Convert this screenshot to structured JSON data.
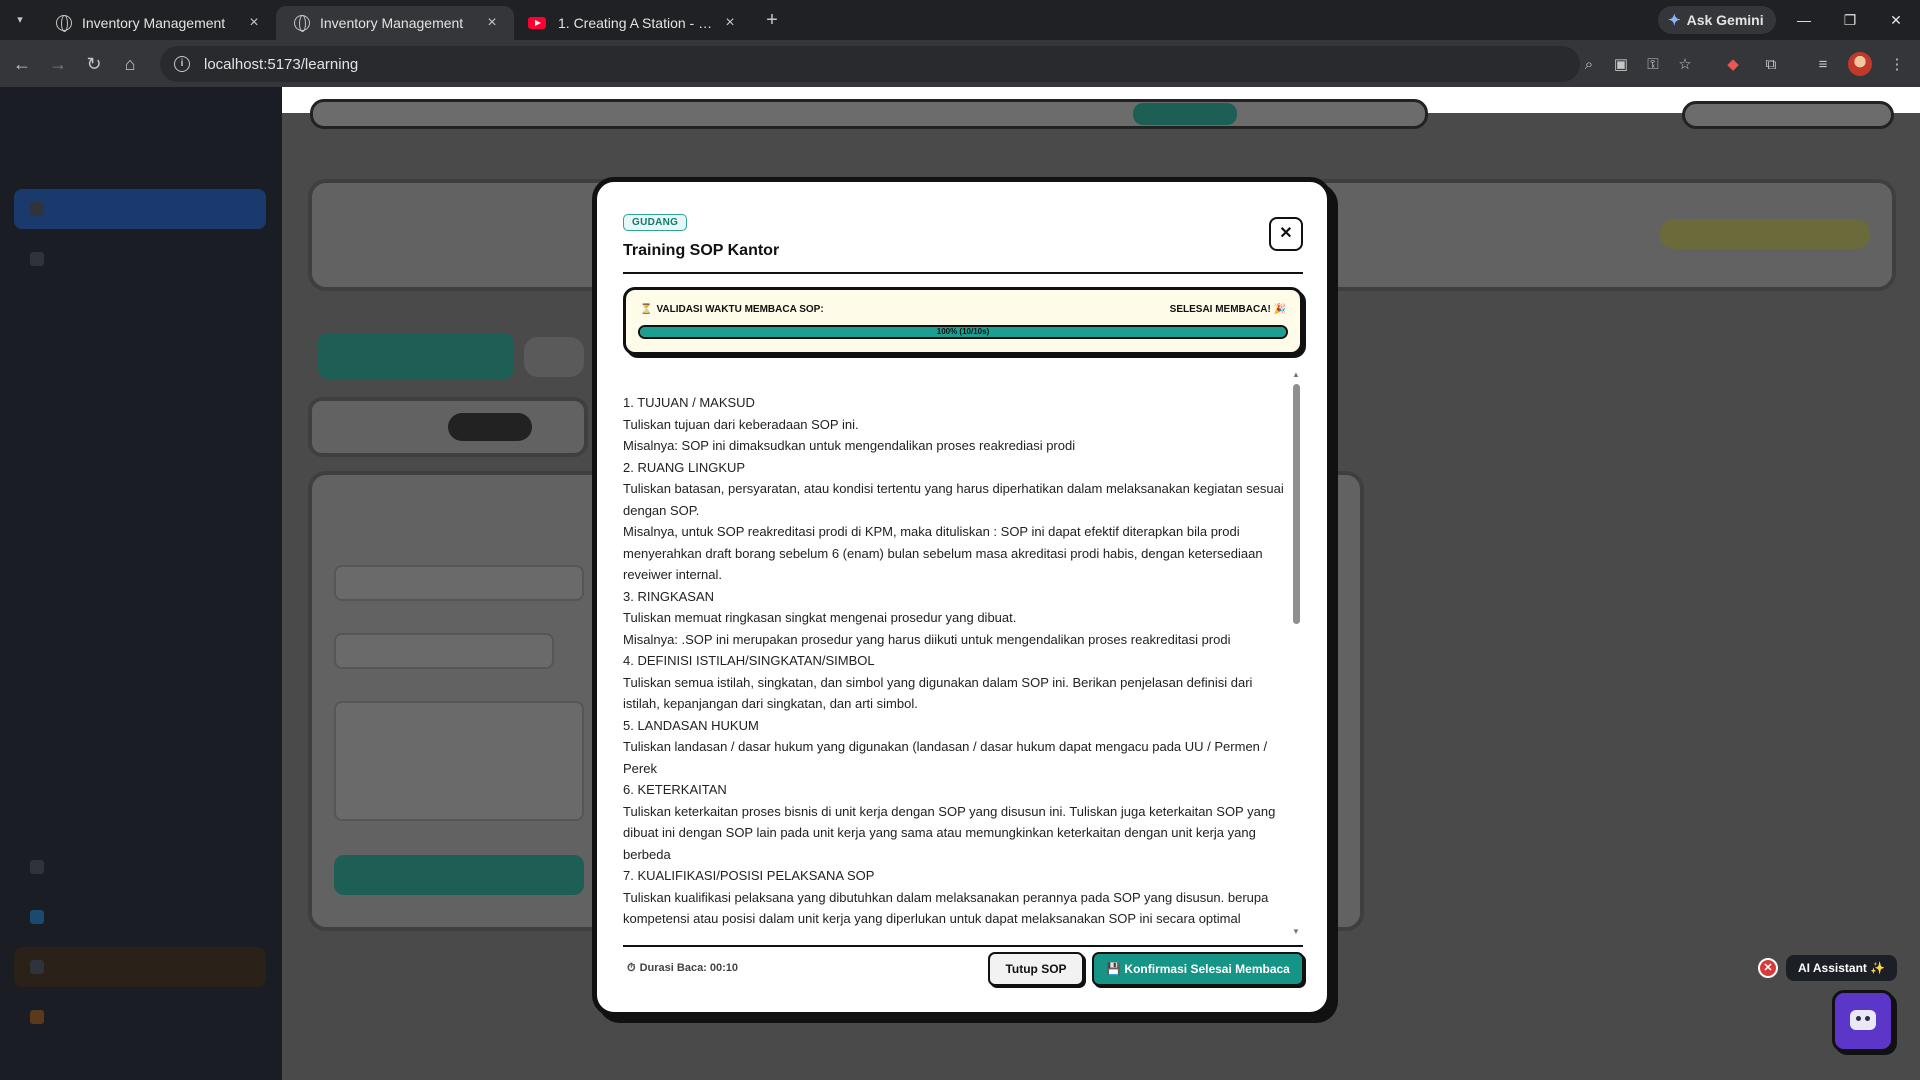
{
  "browser": {
    "tabs": [
      {
        "label": "Inventory Management",
        "active": false
      },
      {
        "label": "Inventory Management",
        "active": true
      },
      {
        "label": "1. Creating A Station - Niagara",
        "active": false
      }
    ],
    "ask_gemini": "Ask Gemini",
    "url": "localhost:5173/learning"
  },
  "modal": {
    "badge": "GUDANG",
    "title": "Training SOP Kantor",
    "timer_label": "VALIDASI WAKTU MEMBACA SOP:",
    "timer_done": "SELESAI MEMBACA! 🎉",
    "progress_text": "100% (10/10s)",
    "progress": 1.0,
    "content": [
      "1. TUJUAN / MAKSUD",
      "Tuliskan tujuan dari keberadaan SOP ini.",
      "Misalnya: SOP ini dimaksudkan untuk mengendalikan proses reakrediasi prodi",
      "2. RUANG LINGKUP",
      "Tuliskan batasan, persyaratan, atau kondisi tertentu yang harus diperhatikan dalam melaksanakan kegiatan sesuai dengan SOP.",
      "Misalnya, untuk SOP reakreditasi prodi di KPM, maka dituliskan : SOP ini dapat efektif diterapkan bila prodi menyerahkan draft borang sebelum 6 (enam) bulan sebelum masa akreditasi prodi habis, dengan ketersediaan reveiwer internal.",
      "3. RINGKASAN",
      "Tuliskan memuat ringkasan singkat mengenai prosedur yang dibuat.",
      "Misalnya: .SOP ini merupakan prosedur yang harus diikuti untuk mengendalikan proses reakreditasi prodi",
      "4. DEFINISI ISTILAH/SINGKATAN/SIMBOL",
      "Tuliskan semua istilah, singkatan, dan simbol yang digunakan dalam SOP ini. Berikan penjelasan definisi dari istilah, kepanjangan dari singkatan, dan arti simbol.",
      "5. LANDASAN HUKUM",
      "Tuliskan landasan / dasar hukum yang digunakan (landasan / dasar hukum dapat mengacu pada UU / Permen / Perek",
      "6. KETERKAITAN",
      "Tuliskan keterkaitan proses bisnis di unit kerja dengan SOP yang disusun ini. Tuliskan juga keterkaitan SOP yang dibuat ini dengan SOP lain pada unit kerja yang sama atau memungkinkan keterkaitan dengan unit kerja yang berbeda",
      "7. KUALIFIKASI/POSISI PELAKSANA SOP",
      "Tuliskan kualifikasi pelaksana yang dibutuhkan dalam melaksanakan perannya pada SOP yang disusun. berupa kompetensi atau posisi dalam unit kerja yang diperlukan untuk dapat melaksanakan SOP ini secara optimal"
    ],
    "duration": "Durasi Baca: 00:10",
    "close_button": "Tutup SOP",
    "confirm_button": "💾 Konfirmasi Selesai Membaca"
  },
  "ai_assistant": {
    "label": "AI Assistant ✨"
  },
  "colors": {
    "accent": "#169486",
    "badge_border": "#2aa59a",
    "timer_bg": "#fffbe9",
    "ai_bot": "#5c35c9",
    "close_red": "#d83a3a"
  }
}
